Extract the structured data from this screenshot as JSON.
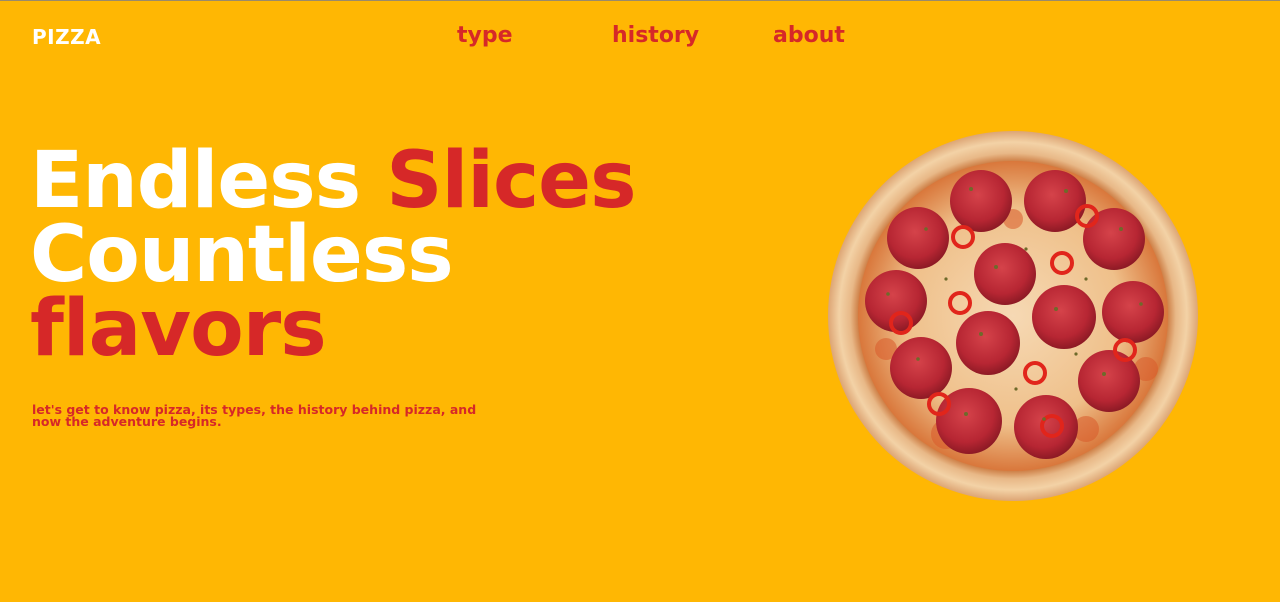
{
  "brand": {
    "logo": "PIZZA"
  },
  "nav": {
    "items": [
      {
        "label": "type"
      },
      {
        "label": "history"
      },
      {
        "label": "about"
      }
    ]
  },
  "hero": {
    "title_line1_a": "Endless",
    "title_line1_b": "Slices",
    "title_line2": "Countless",
    "title_line3": "flavors",
    "description": "let's get to know pizza, its types, the history behind pizza, and now the adventure begins."
  },
  "colors": {
    "background": "#FFB703",
    "accent_red": "#D62828",
    "text_white": "#FFFFFF"
  },
  "image": {
    "subject": "pepperoni-pizza"
  }
}
